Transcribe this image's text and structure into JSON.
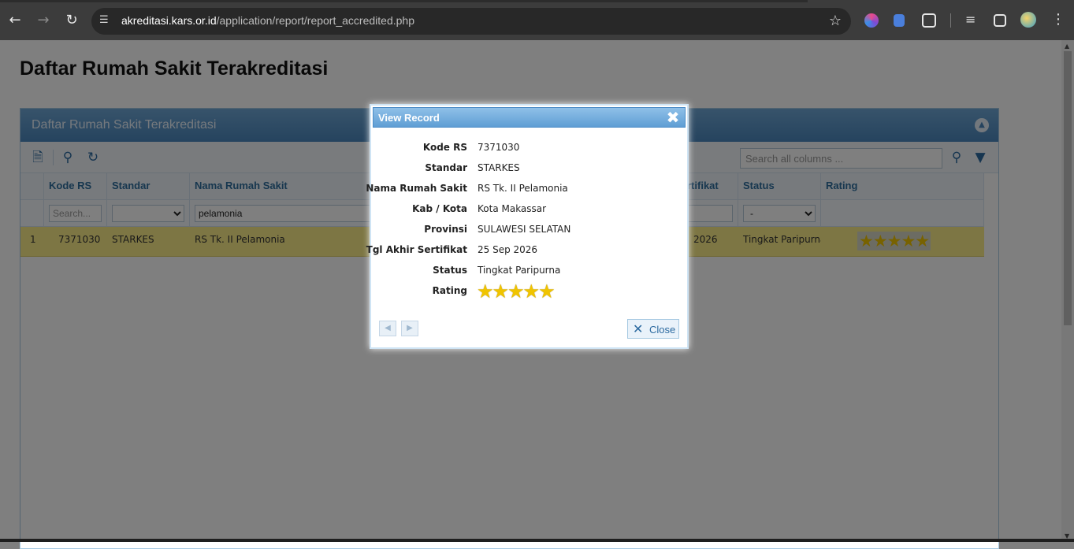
{
  "browser": {
    "url_domain": "akreditasi.kars.or.id",
    "url_path": "/application/report/report_accredited.php"
  },
  "page": {
    "title": "Daftar Rumah Sakit Terakreditasi"
  },
  "grid": {
    "caption": "Daftar Rumah Sakit Terakreditasi",
    "search_placeholder": "Search all columns ...",
    "headers": {
      "kode_rs": "Kode RS",
      "standar": "Standar",
      "nama": "Nama Rumah Sakit",
      "sertifikat": "rtifikat",
      "status": "Status",
      "rating": "Rating"
    },
    "filters": {
      "kode_placeholder": "Search...",
      "nama_value": "pelamonia",
      "status_selected": "-"
    },
    "row": {
      "num": "1",
      "kode": "7371030",
      "standar": "STARKES",
      "nama": "RS Tk. II Pelamonia",
      "sertifikat": "2026",
      "status": "Tingkat Paripurna",
      "rating_stars": 5,
      "stars_text": "★★★★★"
    }
  },
  "modal": {
    "title": "View Record",
    "fields": [
      {
        "label": "Kode RS",
        "value": "7371030"
      },
      {
        "label": "Standar",
        "value": "STARKES"
      },
      {
        "label": "Nama Rumah Sakit",
        "value": "RS Tk. II Pelamonia"
      },
      {
        "label": "Kab / Kota",
        "value": "Kota Makassar"
      },
      {
        "label": "Provinsi",
        "value": "SULAWESI SELATAN"
      },
      {
        "label": "Tgl Akhir Sertifikat",
        "value": "25 Sep 2026"
      },
      {
        "label": "Status",
        "value": "Tingkat Paripurna"
      },
      {
        "label": "Rating",
        "value": ""
      }
    ],
    "rating_stars": 5,
    "stars_text": "★★★★★",
    "close_label": "Close"
  },
  "colors": {
    "accent": "#2c6aa0",
    "row_highlight": "#fbec88",
    "star": "#f0c400"
  }
}
